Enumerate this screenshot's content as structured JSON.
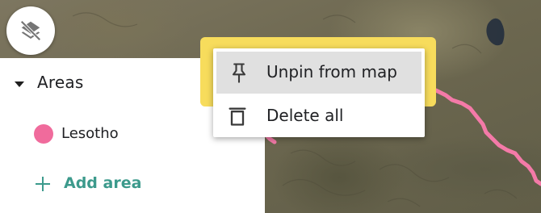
{
  "map": {
    "boundary_color": "#f47aa8",
    "layer_toggle_icon": "layers-off-icon"
  },
  "sidebar": {
    "section_title": "Areas",
    "areas": [
      {
        "label": "Lesotho",
        "color": "#f06b9c"
      }
    ],
    "add_area_label": "Add area"
  },
  "context_menu": {
    "items": [
      {
        "label": "Unpin from map",
        "icon": "pin-icon",
        "highlighted": true
      },
      {
        "label": "Delete all",
        "icon": "trash-icon",
        "highlighted": false
      }
    ]
  },
  "colors": {
    "accent": "#3c9a8c",
    "highlight": "#f7dc5c",
    "area_dot": "#f06b9c"
  }
}
